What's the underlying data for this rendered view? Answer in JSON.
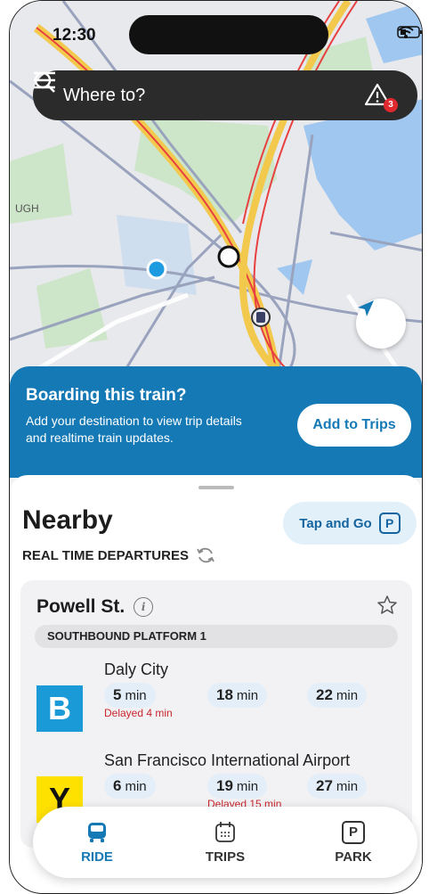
{
  "status_bar": {
    "time": "12:30"
  },
  "search": {
    "label": "Where to?",
    "alert_count": "3"
  },
  "map": {
    "place_label": "UGH"
  },
  "banner": {
    "title": "Boarding this train?",
    "text": "Add your destination to view trip details and realtime train updates.",
    "button": "Add to Trips"
  },
  "nearby": {
    "title": "Nearby",
    "subtitle": "REAL TIME DEPARTURES",
    "tap_go_label": "Tap and Go",
    "tap_go_icon_letter": "P"
  },
  "station": {
    "name": "Powell St.",
    "info_letter": "i",
    "platform": "SOUTHBOUND PLATFORM 1",
    "routes": [
      {
        "letter": "B",
        "color": "#1a9bd7",
        "text_color": "#ffffff",
        "destination": "Daly City",
        "times": [
          {
            "value": "5",
            "unit": "min",
            "delay": "Delayed 4 min"
          },
          {
            "value": "18",
            "unit": "min",
            "delay": ""
          },
          {
            "value": "22",
            "unit": "min",
            "delay": ""
          }
        ]
      },
      {
        "letter": "Y",
        "color": "#ffe100",
        "text_color": "#111111",
        "destination": "San Francisco International Airport",
        "times": [
          {
            "value": "6",
            "unit": "min",
            "delay": ""
          },
          {
            "value": "19",
            "unit": "min",
            "delay": "Delayed 15 min"
          },
          {
            "value": "27",
            "unit": "min",
            "delay": ""
          }
        ]
      }
    ]
  },
  "tabs": [
    {
      "label": "RIDE",
      "icon": "bus-icon",
      "active": true
    },
    {
      "label": "TRIPS",
      "icon": "calendar-icon",
      "active": false
    },
    {
      "label": "PARK",
      "icon": "parking-icon",
      "active": false,
      "icon_letter": "P"
    }
  ],
  "colors": {
    "accent": "#1479b5",
    "delay": "#c9262d"
  }
}
